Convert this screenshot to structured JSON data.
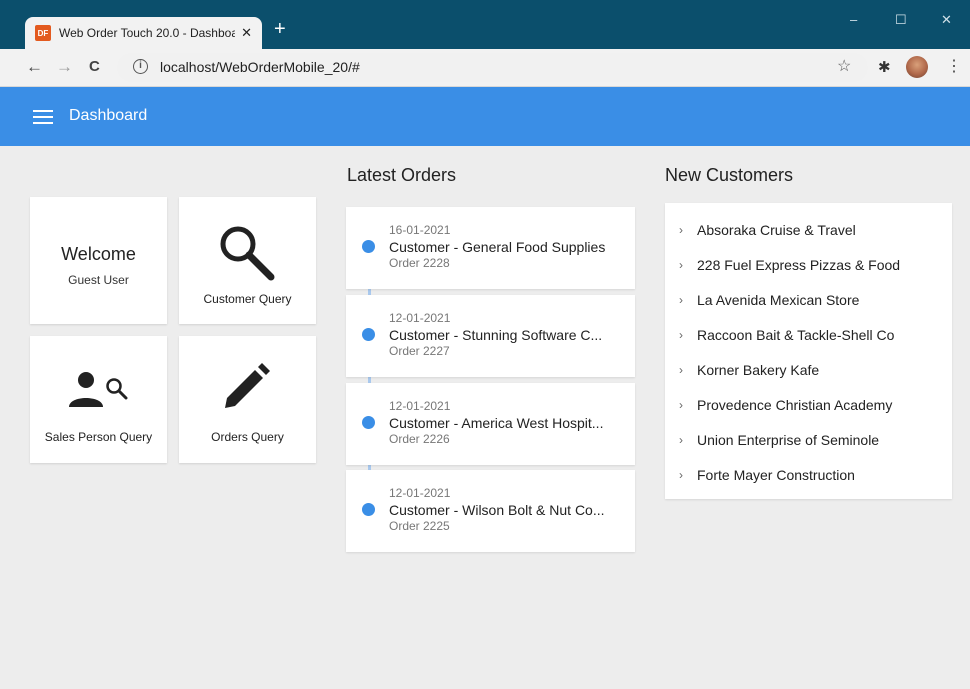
{
  "browser": {
    "tab_title": "Web Order Touch 20.0 - Dashboa",
    "favicon_text": "DF",
    "close_glyph": "✕",
    "newtab_glyph": "+",
    "url": "localhost/WebOrderMobile_20/#",
    "window_controls": {
      "minimize": "–",
      "maximize": "☐",
      "close": "✕"
    },
    "nav": {
      "back": "←",
      "forward": "→",
      "reload": "C"
    },
    "star_glyph": "☆",
    "menu_glyph": "⋮",
    "extensions_icon": "puzzle-icon"
  },
  "app": {
    "title": "Dashboard",
    "accent": "#3a8ee6"
  },
  "tiles": {
    "welcome_title": "Welcome",
    "welcome_user": "Guest User",
    "customer_query": "Customer Query",
    "sales_person_query": "Sales Person Query",
    "orders_query": "Orders Query"
  },
  "latest_orders": {
    "title": "Latest Orders",
    "items": [
      {
        "date": "16-01-2021",
        "customer": "Customer - General Food Supplies",
        "order": "Order 2228"
      },
      {
        "date": "12-01-2021",
        "customer": "Customer - Stunning Software C...",
        "order": "Order 2227"
      },
      {
        "date": "12-01-2021",
        "customer": "Customer - America West Hospit...",
        "order": "Order 2226"
      },
      {
        "date": "12-01-2021",
        "customer": "Customer - Wilson Bolt & Nut Co...",
        "order": "Order 2225"
      }
    ]
  },
  "new_customers": {
    "title": "New Customers",
    "chevron": "›",
    "items": [
      "Absoraka Cruise & Travel",
      "228 Fuel Express Pizzas & Food",
      "La Avenida Mexican Store",
      "Raccoon Bait & Tackle-Shell Co",
      "Korner Bakery Kafe",
      "Provedence Christian Academy",
      "Union Enterprise of Seminole",
      "Forte Mayer Construction"
    ]
  }
}
